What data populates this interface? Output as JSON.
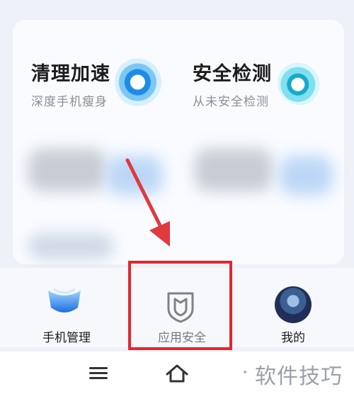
{
  "features": [
    {
      "title": "清理加速",
      "subtitle": "深度手机瘦身",
      "icon": "fan-cleaner-icon"
    },
    {
      "title": "安全检测",
      "subtitle": "从未安全检测",
      "icon": "security-scan-icon"
    }
  ],
  "bottom_nav": {
    "items": [
      {
        "label": "手机管理",
        "icon": "phone-manager-logo-icon"
      },
      {
        "label": "应用安全",
        "icon": "shield-icon",
        "highlighted": true
      },
      {
        "label": "我的",
        "icon": "avatar"
      }
    ]
  },
  "system_bar": {
    "icons": [
      "menu-icon",
      "home-icon"
    ]
  },
  "watermark": {
    "text": "软件技巧"
  },
  "colors": {
    "accent_blue": "#1e8ce6",
    "highlight_red": "#e2262e",
    "arrow_red": "#e0393e"
  }
}
